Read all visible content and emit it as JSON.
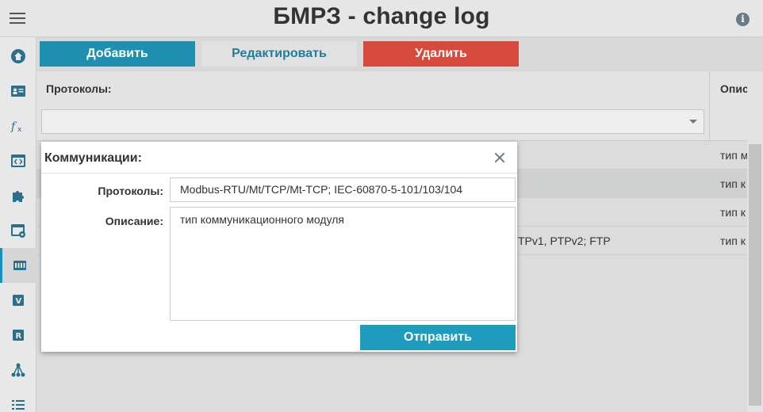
{
  "header": {
    "title": "БМРЗ - change log"
  },
  "toolbar": {
    "add_label": "Добавить",
    "edit_label": "Редактировать",
    "delete_label": "Удалить"
  },
  "table": {
    "col_protocols": "Протоколы:",
    "col_description": "Описа",
    "filter_value": "",
    "rows": [
      {
        "protocols": "",
        "description": "тип м"
      },
      {
        "protocols": "",
        "description": "тип к"
      },
      {
        "protocols": "",
        "description": "тип к"
      },
      {
        "protocols": "TPv1, PTPv2; FTP",
        "description": "тип к"
      }
    ]
  },
  "sidebar": {
    "items": [
      "home-icon",
      "contact-card-icon",
      "function-icon",
      "code-window-icon",
      "puzzle-icon",
      "window-settings-icon",
      "network-card-icon",
      "v-icon",
      "r-icon",
      "hierarchy-icon",
      "list-icon"
    ],
    "active_item": "network-card-icon"
  },
  "modal": {
    "title": "Коммуникации:",
    "protocols_label": "Протоколы:",
    "protocols_value": "Modbus-RTU/Mt/TCP/Mt-TCP; IEC-60870-5-101/103/104",
    "description_label": "Описание:",
    "description_value": "тип коммуникационного модуля",
    "submit_label": "Отправить"
  },
  "colors": {
    "primary": "#1e8fae",
    "danger": "#d74b3f",
    "icon": "#2a6f8c"
  }
}
